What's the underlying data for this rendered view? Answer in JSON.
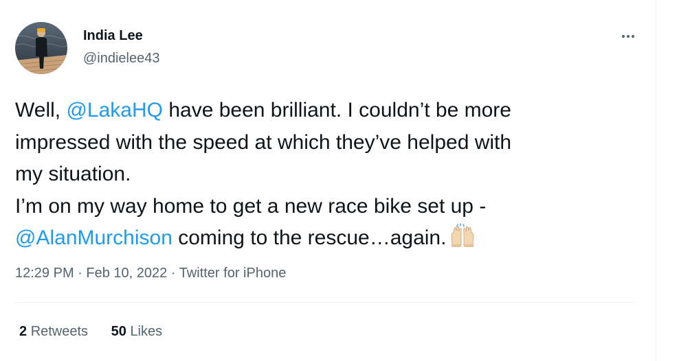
{
  "tweet": {
    "author_name": "India Lee",
    "author_handle": "@indielee43",
    "more_icon": "more-horizontal-icon",
    "body": {
      "line1_pre": "Well, ",
      "line1_mention": "@LakaHQ",
      "line1_post": " have been brilliant. I couldn’t be more",
      "line2": "impressed with the speed at which they’ve helped with",
      "line3": "my situation.",
      "line4": "I’m on my way home to get a new race bike set up -",
      "line5_mention": "@AlanMurchison",
      "line5_post": " coming to the rescue…again.",
      "emoji_icon": "raising-hands-emoji-icon"
    },
    "meta": {
      "time": "12:29 PM",
      "separator": " · ",
      "date": "Feb 10, 2022",
      "source": "Twitter for iPhone"
    },
    "stats": {
      "retweets_count": "2",
      "retweets_label": "Retweets",
      "likes_count": "50",
      "likes_label": "Likes"
    }
  },
  "colors": {
    "link": "#1d9bf0",
    "text": "#0f1419",
    "secondary": "#536471",
    "divider": "#eff3f4"
  }
}
